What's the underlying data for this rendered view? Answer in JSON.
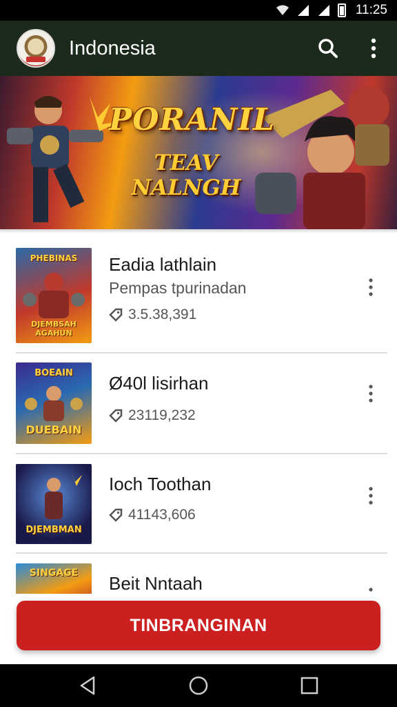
{
  "status_bar": {
    "time": "11:25"
  },
  "app_bar": {
    "title": "Indonesia"
  },
  "banner": {
    "title": "PORANIL",
    "subtitle": "TEAV NALNGH"
  },
  "items": [
    {
      "title": "Eadia lathlain",
      "subtitle": "Pempas tpurinadan",
      "count": "3.5.38,391",
      "thumb_text_top": "PHEBINAS",
      "thumb_text_bottom": "DJEMBSAH AGAHUN"
    },
    {
      "title": "Ø40l lisirhan",
      "subtitle": "",
      "count": "23119,232",
      "thumb_text_top": "BOEAIN",
      "thumb_text_bottom": "DUEBAIN"
    },
    {
      "title": "Ioch Toothan",
      "subtitle": "",
      "count": "41143,606",
      "thumb_text_top": "",
      "thumb_text_bottom": "DJEMBMAN"
    },
    {
      "title": "Beit Nntaah",
      "subtitle": "",
      "count": "",
      "thumb_text_top": "SINGAGE",
      "thumb_text_bottom": ""
    }
  ],
  "cta": {
    "label": "TINBRANGINAN"
  },
  "colors": {
    "app_bar": "#1c2a1c",
    "cta": "#cc2020",
    "accent_gold": "#ffd23f"
  }
}
